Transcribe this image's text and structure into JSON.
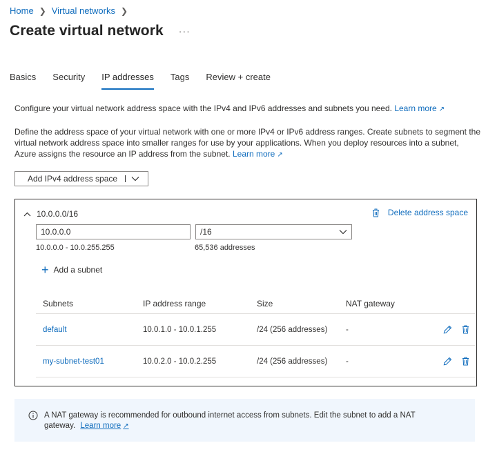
{
  "breadcrumb": [
    {
      "label": "Home"
    },
    {
      "label": "Virtual networks"
    }
  ],
  "page_title": "Create virtual network",
  "more_label": "···",
  "tabs": [
    {
      "label": "Basics",
      "active": false
    },
    {
      "label": "Security",
      "active": false
    },
    {
      "label": "IP addresses",
      "active": true
    },
    {
      "label": "Tags",
      "active": false
    },
    {
      "label": "Review + create",
      "active": false
    }
  ],
  "intro": {
    "text": "Configure your virtual network address space with the IPv4 and IPv6 addresses and subnets you need.",
    "link": "Learn more"
  },
  "define": {
    "text": "Define the address space of your virtual network with one or more IPv4 or IPv6 address ranges. Create subnets to segment the virtual network address space into smaller ranges for use by your applications. When you deploy resources into a subnet, Azure assigns the resource an IP address from the subnet.",
    "link": "Learn more"
  },
  "add_space_button": "Add IPv4 address space",
  "address_space": {
    "title": "10.0.0.0/16",
    "delete_label": "Delete address space",
    "ip_value": "10.0.0.0",
    "prefix_value": "/16",
    "range": "10.0.0.0 - 10.0.255.255",
    "count": "65,536 addresses",
    "add_subnet_label": "Add a subnet"
  },
  "subnet_table": {
    "headers": [
      "Subnets",
      "IP address range",
      "Size",
      "NAT gateway"
    ],
    "rows": [
      {
        "name": "default",
        "range": "10.0.1.0 - 10.0.1.255",
        "size": "/24 (256 addresses)",
        "nat": "-"
      },
      {
        "name": "my-subnet-test01",
        "range": "10.0.2.0 - 10.0.2.255",
        "size": "/24 (256 addresses)",
        "nat": "-"
      }
    ]
  },
  "info_banner": {
    "text": "A NAT gateway is recommended for outbound internet access from subnets. Edit the subnet to add a NAT gateway.",
    "link": "Learn more"
  },
  "colors": {
    "accent": "#0f6cbd",
    "banner_bg": "#f0f6fd",
    "text": "#323130"
  },
  "icons": {
    "breadcrumb_separator": "chevron-right-icon",
    "collapse": "chevron-up-icon",
    "delete": "trash-icon",
    "edit": "pencil-icon",
    "info": "info-icon",
    "external": "external-link-icon",
    "add": "plus-icon",
    "dropdown": "chevron-down-icon"
  }
}
